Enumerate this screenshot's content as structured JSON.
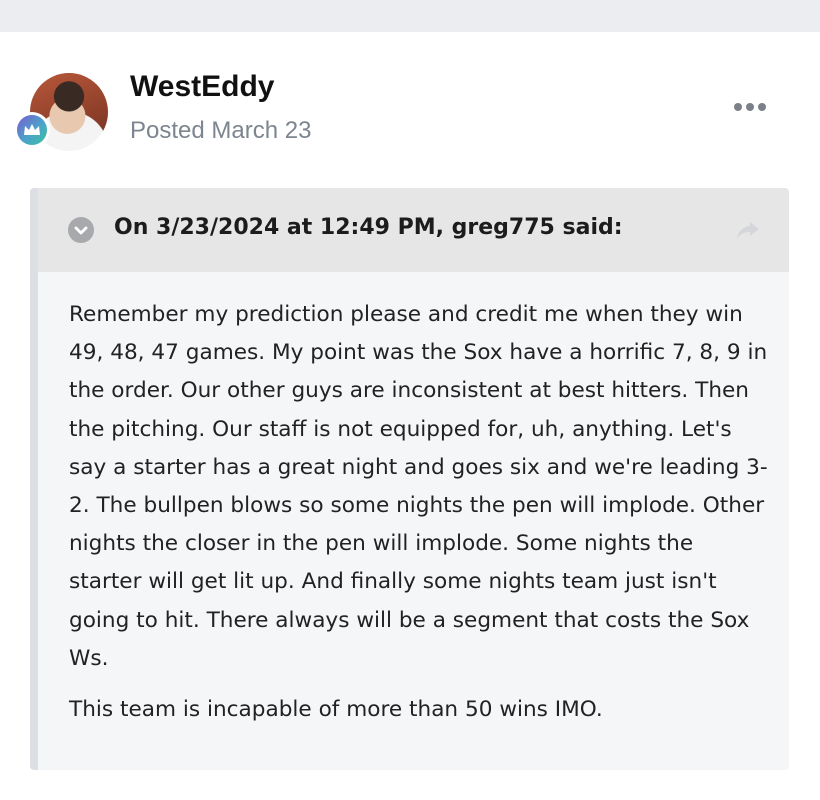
{
  "post": {
    "author": "WestEddy",
    "posted": "Posted March 23",
    "more_icon": "more-horizontal-icon",
    "badge_icon": "crown-icon"
  },
  "quote": {
    "citation": "On 3/23/2024 at 12:49 PM, greg775 said:",
    "toggle_icon": "chevron-down-icon",
    "share_icon": "share-arrow-icon",
    "paragraphs": [
      "Remember my prediction please and credit me when they win 49, 48, 47 games. My point was the Sox have a horrific 7, 8, 9 in the order. Our other guys are inconsistent at best hitters. Then the pitching. Our staff is not equipped for, uh, anything. Let's say a starter has a great night and goes six and we're leading 3-2. The bullpen blows so some nights the pen will implode. Other nights the closer in the pen will implode. Some nights the starter will get lit up. And finally some nights team just isn't going to hit. There always will be a segment that costs the Sox Ws.",
      "This team is incapable of more than 50 wins IMO."
    ]
  },
  "colors": {
    "quote_background": "#f5f6f8",
    "quote_header": "#e6e6e6",
    "secondary_text": "#7d8590"
  }
}
